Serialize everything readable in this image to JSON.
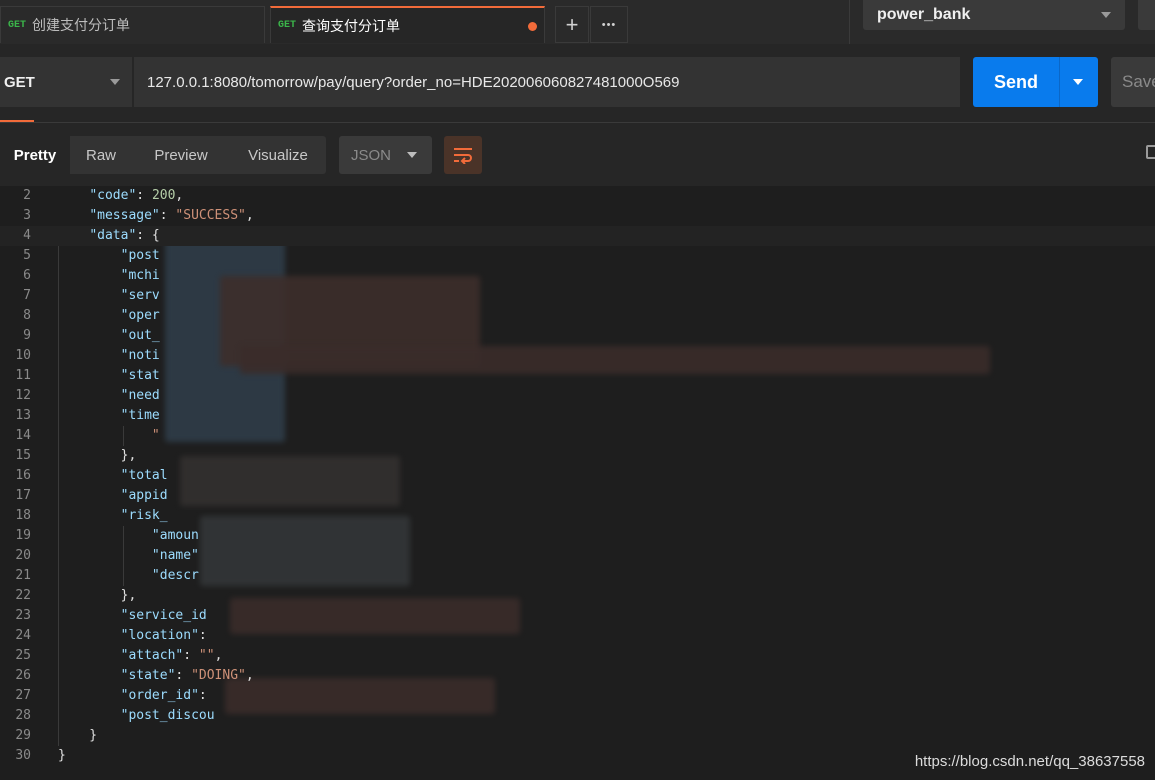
{
  "tabs": [
    {
      "method": "GET",
      "title": "创建支付分订单",
      "active": false
    },
    {
      "method": "GET",
      "title": "查询支付分订单",
      "active": true
    }
  ],
  "tab_actions": {
    "add_icon": "plus-icon",
    "more_icon": "ellipsis-icon",
    "add_glyph": "+",
    "more_glyph": "•••"
  },
  "environment": {
    "selected": "power_bank"
  },
  "request": {
    "method": "GET",
    "url": "127.0.0.1:8080/tomorrow/pay/query?order_no=HDE202006060827481000O569",
    "send_label": "Send",
    "save_label": "Save"
  },
  "response": {
    "view_tabs": [
      "Pretty",
      "Raw",
      "Preview",
      "Visualize"
    ],
    "active_view": "Pretty",
    "format": "JSON",
    "wrap_icon": "wrap-lines-icon",
    "copy_icon": "copy-icon"
  },
  "code_lines": [
    {
      "n": "2",
      "parts": [
        [
          "p",
          "    "
        ],
        [
          "k",
          "\"code\""
        ],
        [
          "p",
          ": "
        ],
        [
          "n",
          "200"
        ],
        [
          "p",
          ","
        ]
      ]
    },
    {
      "n": "3",
      "parts": [
        [
          "p",
          "    "
        ],
        [
          "k",
          "\"message\""
        ],
        [
          "p",
          ": "
        ],
        [
          "s",
          "\"SUCCESS\""
        ],
        [
          "p",
          ","
        ]
      ]
    },
    {
      "n": "4",
      "parts": [
        [
          "p",
          "    "
        ],
        [
          "k",
          "\"data\""
        ],
        [
          "p",
          ": {"
        ]
      ]
    },
    {
      "n": "5",
      "parts": [
        [
          "p",
          "        "
        ],
        [
          "k",
          "\"post"
        ]
      ]
    },
    {
      "n": "6",
      "parts": [
        [
          "p",
          "        "
        ],
        [
          "k",
          "\"mchi"
        ]
      ]
    },
    {
      "n": "7",
      "parts": [
        [
          "p",
          "        "
        ],
        [
          "k",
          "\"serv"
        ]
      ]
    },
    {
      "n": "8",
      "parts": [
        [
          "p",
          "        "
        ],
        [
          "k",
          "\"oper"
        ]
      ]
    },
    {
      "n": "9",
      "parts": [
        [
          "p",
          "        "
        ],
        [
          "k",
          "\"out_"
        ]
      ]
    },
    {
      "n": "10",
      "parts": [
        [
          "p",
          "        "
        ],
        [
          "k",
          "\"noti"
        ]
      ]
    },
    {
      "n": "11",
      "parts": [
        [
          "p",
          "        "
        ],
        [
          "k",
          "\"stat"
        ]
      ]
    },
    {
      "n": "12",
      "parts": [
        [
          "p",
          "        "
        ],
        [
          "k",
          "\"need"
        ]
      ]
    },
    {
      "n": "13",
      "parts": [
        [
          "p",
          "        "
        ],
        [
          "k",
          "\"time"
        ]
      ]
    },
    {
      "n": "14",
      "parts": [
        [
          "p",
          "            "
        ],
        [
          "s",
          "\""
        ]
      ]
    },
    {
      "n": "15",
      "parts": [
        [
          "p",
          "        },"
        ]
      ]
    },
    {
      "n": "16",
      "parts": [
        [
          "p",
          "        "
        ],
        [
          "k",
          "\"total"
        ]
      ]
    },
    {
      "n": "17",
      "parts": [
        [
          "p",
          "        "
        ],
        [
          "k",
          "\"appid"
        ]
      ]
    },
    {
      "n": "18",
      "parts": [
        [
          "p",
          "        "
        ],
        [
          "k",
          "\"risk_"
        ]
      ]
    },
    {
      "n": "19",
      "parts": [
        [
          "p",
          "            "
        ],
        [
          "k",
          "\"amoun"
        ]
      ]
    },
    {
      "n": "20",
      "parts": [
        [
          "p",
          "            "
        ],
        [
          "k",
          "\"name\""
        ]
      ]
    },
    {
      "n": "21",
      "parts": [
        [
          "p",
          "            "
        ],
        [
          "k",
          "\"descr"
        ]
      ]
    },
    {
      "n": "22",
      "parts": [
        [
          "p",
          "        },"
        ]
      ]
    },
    {
      "n": "23",
      "parts": [
        [
          "p",
          "        "
        ],
        [
          "k",
          "\"service_id"
        ]
      ]
    },
    {
      "n": "24",
      "parts": [
        [
          "p",
          "        "
        ],
        [
          "k",
          "\"location\""
        ],
        [
          "p",
          ":"
        ]
      ]
    },
    {
      "n": "25",
      "parts": [
        [
          "p",
          "        "
        ],
        [
          "k",
          "\"attach\""
        ],
        [
          "p",
          ": "
        ],
        [
          "s",
          "\"\""
        ],
        [
          "p",
          ","
        ]
      ]
    },
    {
      "n": "26",
      "parts": [
        [
          "p",
          "        "
        ],
        [
          "k",
          "\"state\""
        ],
        [
          "p",
          ": "
        ],
        [
          "s",
          "\"DOING\""
        ],
        [
          "p",
          ","
        ]
      ]
    },
    {
      "n": "27",
      "parts": [
        [
          "p",
          "        "
        ],
        [
          "k",
          "\"order_id\""
        ],
        [
          "p",
          ":"
        ]
      ]
    },
    {
      "n": "28",
      "parts": [
        [
          "p",
          "        "
        ],
        [
          "k",
          "\"post_discou"
        ]
      ]
    },
    {
      "n": "29",
      "parts": [
        [
          "p",
          "    }"
        ]
      ]
    },
    {
      "n": "30",
      "parts": [
        [
          "p",
          "}"
        ]
      ]
    }
  ],
  "watermark": "https://blog.csdn.net/qq_38637558",
  "colors": {
    "accent": "#f26b3a",
    "send": "#097bed",
    "get_method": "#3bb54a"
  }
}
